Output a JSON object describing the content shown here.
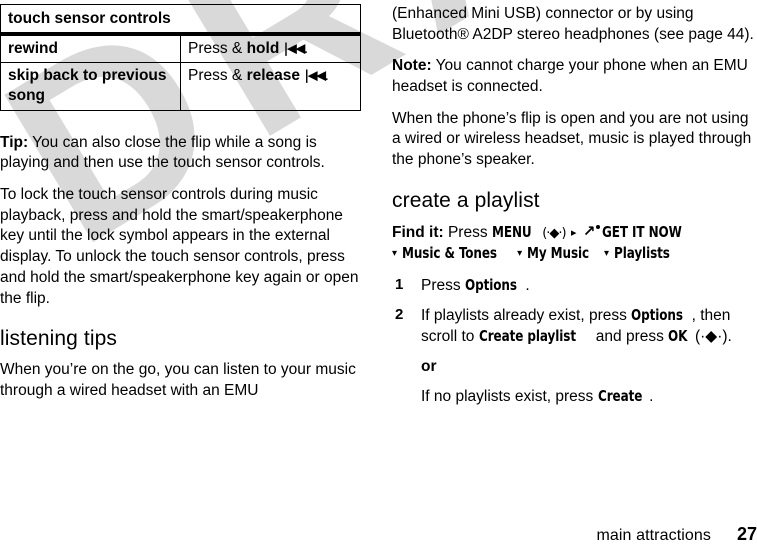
{
  "page": {
    "footer_title": "main attractions",
    "page_number": "27",
    "watermark": "DRAFT",
    "watermark_color": "#d9d9d9"
  },
  "table": {
    "caption": "touch sensor controls",
    "rows": [
      {
        "term": "rewind",
        "desc_prefix": "Press & ",
        "desc_bold": "hold",
        "glyph": "|◀◀",
        "glyph_name": "rewind-icon",
        "desc_suffix": "."
      },
      {
        "term": "skip back to previous song",
        "desc_prefix": "Press & ",
        "desc_bold": "release",
        "glyph": "|◀◀",
        "glyph_name": "rewind-icon",
        "desc_suffix": "."
      }
    ]
  },
  "left_column": {
    "tip_label": "Tip:",
    "tip_text": " You can also close the flip while a song is playing and then use the touch sensor controls.",
    "lock_paragraph": "To lock the touch sensor controls during music playback, press and hold the smart/speakerphone key until the lock symbol appears in the external display. To unlock the touch sensor controls, press and hold the smart/speakerphone key again or open the flip.",
    "listening_heading": "listening tips",
    "listening_text": "When you’re on the go, you can listen to your music through a wired headset with an EMU"
  },
  "right_column": {
    "continued_text_a": "(Enhanced Mini USB) connector or by using Bluetooth® A2DP stereo headphones (see page 44).",
    "note_label": "Note:",
    "note_text": " You cannot charge your phone when an EMU headset is connected.",
    "speaker_paragraph": "When the phone’s flip is open and you are not using a wired or wireless headset, music is played through the phone’s speaker.",
    "playlist_heading": "create a playlist",
    "find_it": {
      "label": "Find it:",
      "press_word": " Press ",
      "menu_key": "MENU",
      "joystick": "(·◆·)",
      "arrow": "▸",
      "shortcut_label": "GET IT NOW",
      "caret": "▾",
      "path": [
        "Music & Tones",
        "My Music",
        "Playlists"
      ]
    },
    "steps": [
      {
        "number": "1",
        "parts": [
          {
            "t": "Press ",
            "b": false
          },
          {
            "t": "Options",
            "b": true
          },
          {
            "t": ".",
            "b": false
          }
        ]
      },
      {
        "number": "2",
        "parts": [
          {
            "t": "If playlists already exist, press ",
            "b": false
          },
          {
            "t": "Options",
            "b": true
          },
          {
            "t": ", then scroll to ",
            "b": false
          },
          {
            "t": "Create playlist",
            "b": true
          },
          {
            "t": " and press ",
            "b": false
          },
          {
            "t": "OK",
            "b": true
          },
          {
            "t": " (·◆·).",
            "b": false
          }
        ]
      }
    ],
    "or_label": "or",
    "step_alt_parts": [
      {
        "t": "If no playlists exist, press ",
        "b": false
      },
      {
        "t": "Create",
        "b": true
      },
      {
        "t": ".",
        "b": false
      }
    ]
  }
}
